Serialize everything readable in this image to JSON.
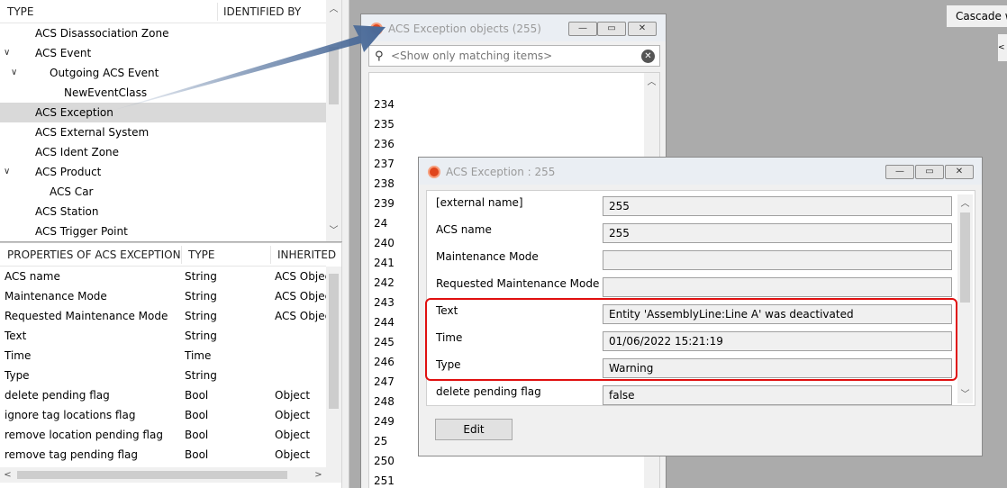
{
  "type_tree": {
    "columns": [
      "TYPE",
      "IDENTIFIED BY"
    ],
    "rows": [
      {
        "label": "ACS Disassociation Zone",
        "indent": 0,
        "expanded": null,
        "selected": false
      },
      {
        "label": "ACS Event",
        "indent": 0,
        "expanded": true,
        "selected": false
      },
      {
        "label": "Outgoing ACS Event",
        "indent": 1,
        "expanded": true,
        "selected": false
      },
      {
        "label": "NewEventClass",
        "indent": 2,
        "expanded": null,
        "selected": false
      },
      {
        "label": "ACS Exception",
        "indent": 0,
        "expanded": null,
        "selected": true
      },
      {
        "label": "ACS External System",
        "indent": 0,
        "expanded": null,
        "selected": false
      },
      {
        "label": "ACS Ident Zone",
        "indent": 0,
        "expanded": null,
        "selected": false
      },
      {
        "label": "ACS Product",
        "indent": 0,
        "expanded": true,
        "selected": false
      },
      {
        "label": "ACS Car",
        "indent": 1,
        "expanded": null,
        "selected": false
      },
      {
        "label": "ACS Station",
        "indent": 0,
        "expanded": null,
        "selected": false
      },
      {
        "label": "ACS Trigger Point",
        "indent": 0,
        "expanded": null,
        "selected": false
      }
    ]
  },
  "properties": {
    "columns": [
      "PROPERTIES OF ACS EXCEPTION",
      "TYPE",
      "INHERITED"
    ],
    "rows": [
      {
        "name": "ACS name",
        "type": "String",
        "inherited": "ACS Object"
      },
      {
        "name": "Maintenance Mode",
        "type": "String",
        "inherited": "ACS Object"
      },
      {
        "name": "Requested Maintenance Mode",
        "type": "String",
        "inherited": "ACS Object"
      },
      {
        "name": "Text",
        "type": "String",
        "inherited": ""
      },
      {
        "name": "Time",
        "type": "Time",
        "inherited": ""
      },
      {
        "name": "Type",
        "type": "String",
        "inherited": ""
      },
      {
        "name": "delete pending flag",
        "type": "Bool",
        "inherited": "Object"
      },
      {
        "name": "ignore tag locations flag",
        "type": "Bool",
        "inherited": "Object"
      },
      {
        "name": "remove location pending flag",
        "type": "Bool",
        "inherited": "Object"
      },
      {
        "name": "remove tag pending flag",
        "type": "Bool",
        "inherited": "Object"
      }
    ]
  },
  "list_window": {
    "title": "ACS Exception objects (255)",
    "filter_placeholder": "<Show only matching items>",
    "items": [
      "234",
      "235",
      "236",
      "237",
      "238",
      "239",
      "24",
      "240",
      "241",
      "242",
      "243",
      "244",
      "245",
      "246",
      "247",
      "248",
      "249",
      "25",
      "250",
      "251"
    ]
  },
  "detail_window": {
    "title": "ACS Exception : 255",
    "fields": [
      {
        "label": "[external name]",
        "value": "255"
      },
      {
        "label": "ACS name",
        "value": "255"
      },
      {
        "label": "Maintenance Mode",
        "value": ""
      },
      {
        "label": "Requested Maintenance Mode",
        "value": ""
      },
      {
        "label": "Text",
        "value": "Entity 'AssemblyLine:Line A' was deactivated"
      },
      {
        "label": "Time",
        "value": "01/06/2022 15:21:19"
      },
      {
        "label": "Type",
        "value": "Warning"
      },
      {
        "label": "delete pending flag",
        "value": "false"
      }
    ],
    "edit_label": "Edit"
  },
  "toolbar": {
    "cascade_label": "Cascade w"
  },
  "colors": {
    "highlight": "#e01010",
    "app_icon": "#e0451b",
    "arrow": "#4a6a98"
  },
  "icons": {
    "app": "app-logo-icon",
    "search": "search-icon",
    "clear": "clear-icon",
    "minimize": "minimize-icon",
    "restore": "restore-icon",
    "close": "close-icon"
  }
}
